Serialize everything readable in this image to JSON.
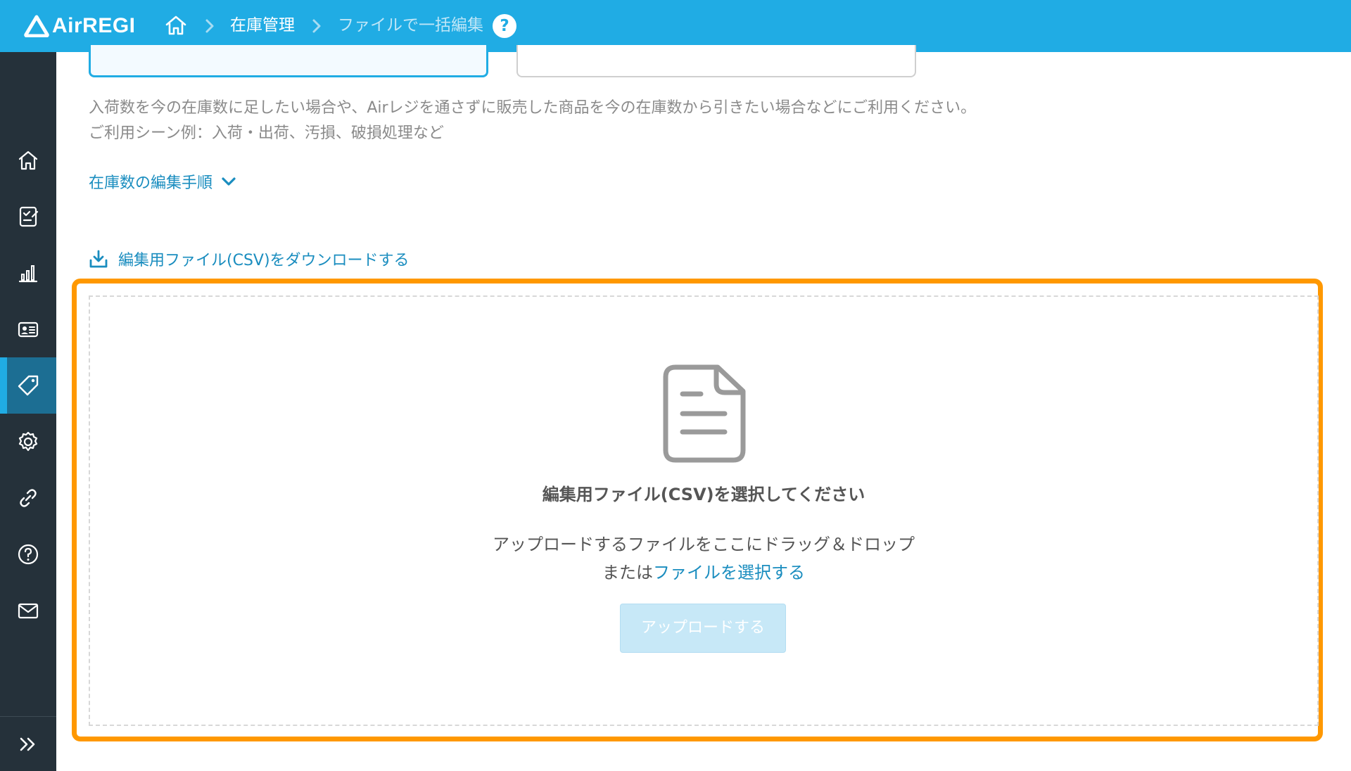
{
  "header": {
    "logo_text": "AirREGI",
    "breadcrumb": [
      "在庫管理",
      "ファイルで一括編集"
    ],
    "help_label": "?",
    "colors": {
      "bar": "#20ace4"
    }
  },
  "sidebar": {
    "items": [
      {
        "icon": "home-icon"
      },
      {
        "icon": "checklist-icon"
      },
      {
        "icon": "bar-chart-icon"
      },
      {
        "icon": "id-card-icon"
      },
      {
        "icon": "tag-icon",
        "active": true
      },
      {
        "icon": "gear-icon"
      },
      {
        "icon": "link-icon"
      },
      {
        "icon": "question-icon"
      },
      {
        "icon": "mail-icon"
      }
    ],
    "expand_icon": "double-chevron-right-icon"
  },
  "main": {
    "description_line1": "入荷数を今の在庫数に足したい場合や、Airレジを通さずに販売した商品を今の在庫数から引きたい場合などにご利用ください。",
    "description_line2": "ご利用シーン例：入荷・出荷、汚損、破損処理など",
    "steps_toggle": "在庫数の編集手順",
    "download_link": "編集用ファイル(CSV)をダウンロードする",
    "dropzone": {
      "title": "編集用ファイル(CSV)を選択してください",
      "hint_line1": "アップロードするファイルをここにドラッグ＆ドロップ",
      "hint_prefix": "または",
      "select_link": "ファイルを選択する",
      "upload_button": "アップロードする"
    }
  }
}
